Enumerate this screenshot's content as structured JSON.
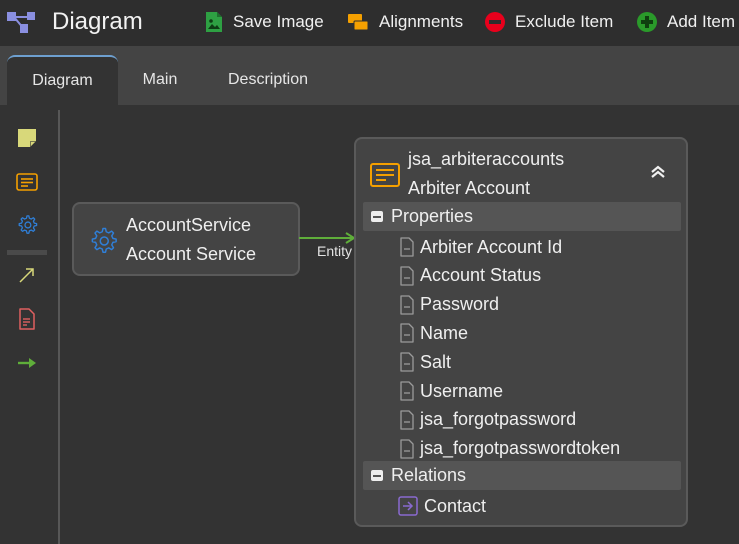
{
  "app": {
    "title": "Diagram"
  },
  "toolbar": {
    "save_image": {
      "label": "Save Image",
      "icon": "image-file-icon",
      "color": "#2ea043"
    },
    "alignments": {
      "label": "Alignments",
      "icon": "alignments-icon",
      "color": "#f5a000"
    },
    "exclude_item": {
      "label": "Exclude Item",
      "icon": "minus-circle-icon",
      "color": "#e8001c"
    },
    "add_item": {
      "label": "Add Item",
      "icon": "plus-circle-icon",
      "color": "#2a9a2a"
    }
  },
  "tabs": [
    {
      "label": "Diagram",
      "active": true
    },
    {
      "label": "Main",
      "active": false
    },
    {
      "label": "Description",
      "active": false
    }
  ],
  "tools": [
    {
      "name": "note-tool",
      "icon": "sticky-note-icon",
      "color": "#d8d87a"
    },
    {
      "name": "entity-tool",
      "icon": "entity-icon",
      "color": "#f5a000"
    },
    {
      "name": "service-tool",
      "icon": "gear-icon",
      "color": "#2f7fd8"
    },
    {
      "name": "association-tool",
      "icon": "diagonal-arrow-icon",
      "color": "#d8d87a"
    },
    {
      "name": "document-tool",
      "icon": "document-icon",
      "color": "#e06060"
    },
    {
      "name": "relation-tool",
      "icon": "right-arrow-icon",
      "color": "#5fae3a"
    }
  ],
  "diagram": {
    "service_node": {
      "name": "AccountService",
      "display_name": "Account Service"
    },
    "connector": {
      "label": "Entity",
      "color": "#5fae3a"
    },
    "entity_node": {
      "name": "jsa_arbiteraccounts",
      "display_name": "Arbiter Account",
      "properties_label": "Properties",
      "properties": [
        "Arbiter Account Id",
        "Account Status",
        "Password",
        "Name",
        "Salt",
        "Username",
        "jsa_forgotpassword",
        "jsa_forgotpasswordtoken"
      ],
      "relations_label": "Relations",
      "relations": [
        "Contact"
      ]
    }
  }
}
